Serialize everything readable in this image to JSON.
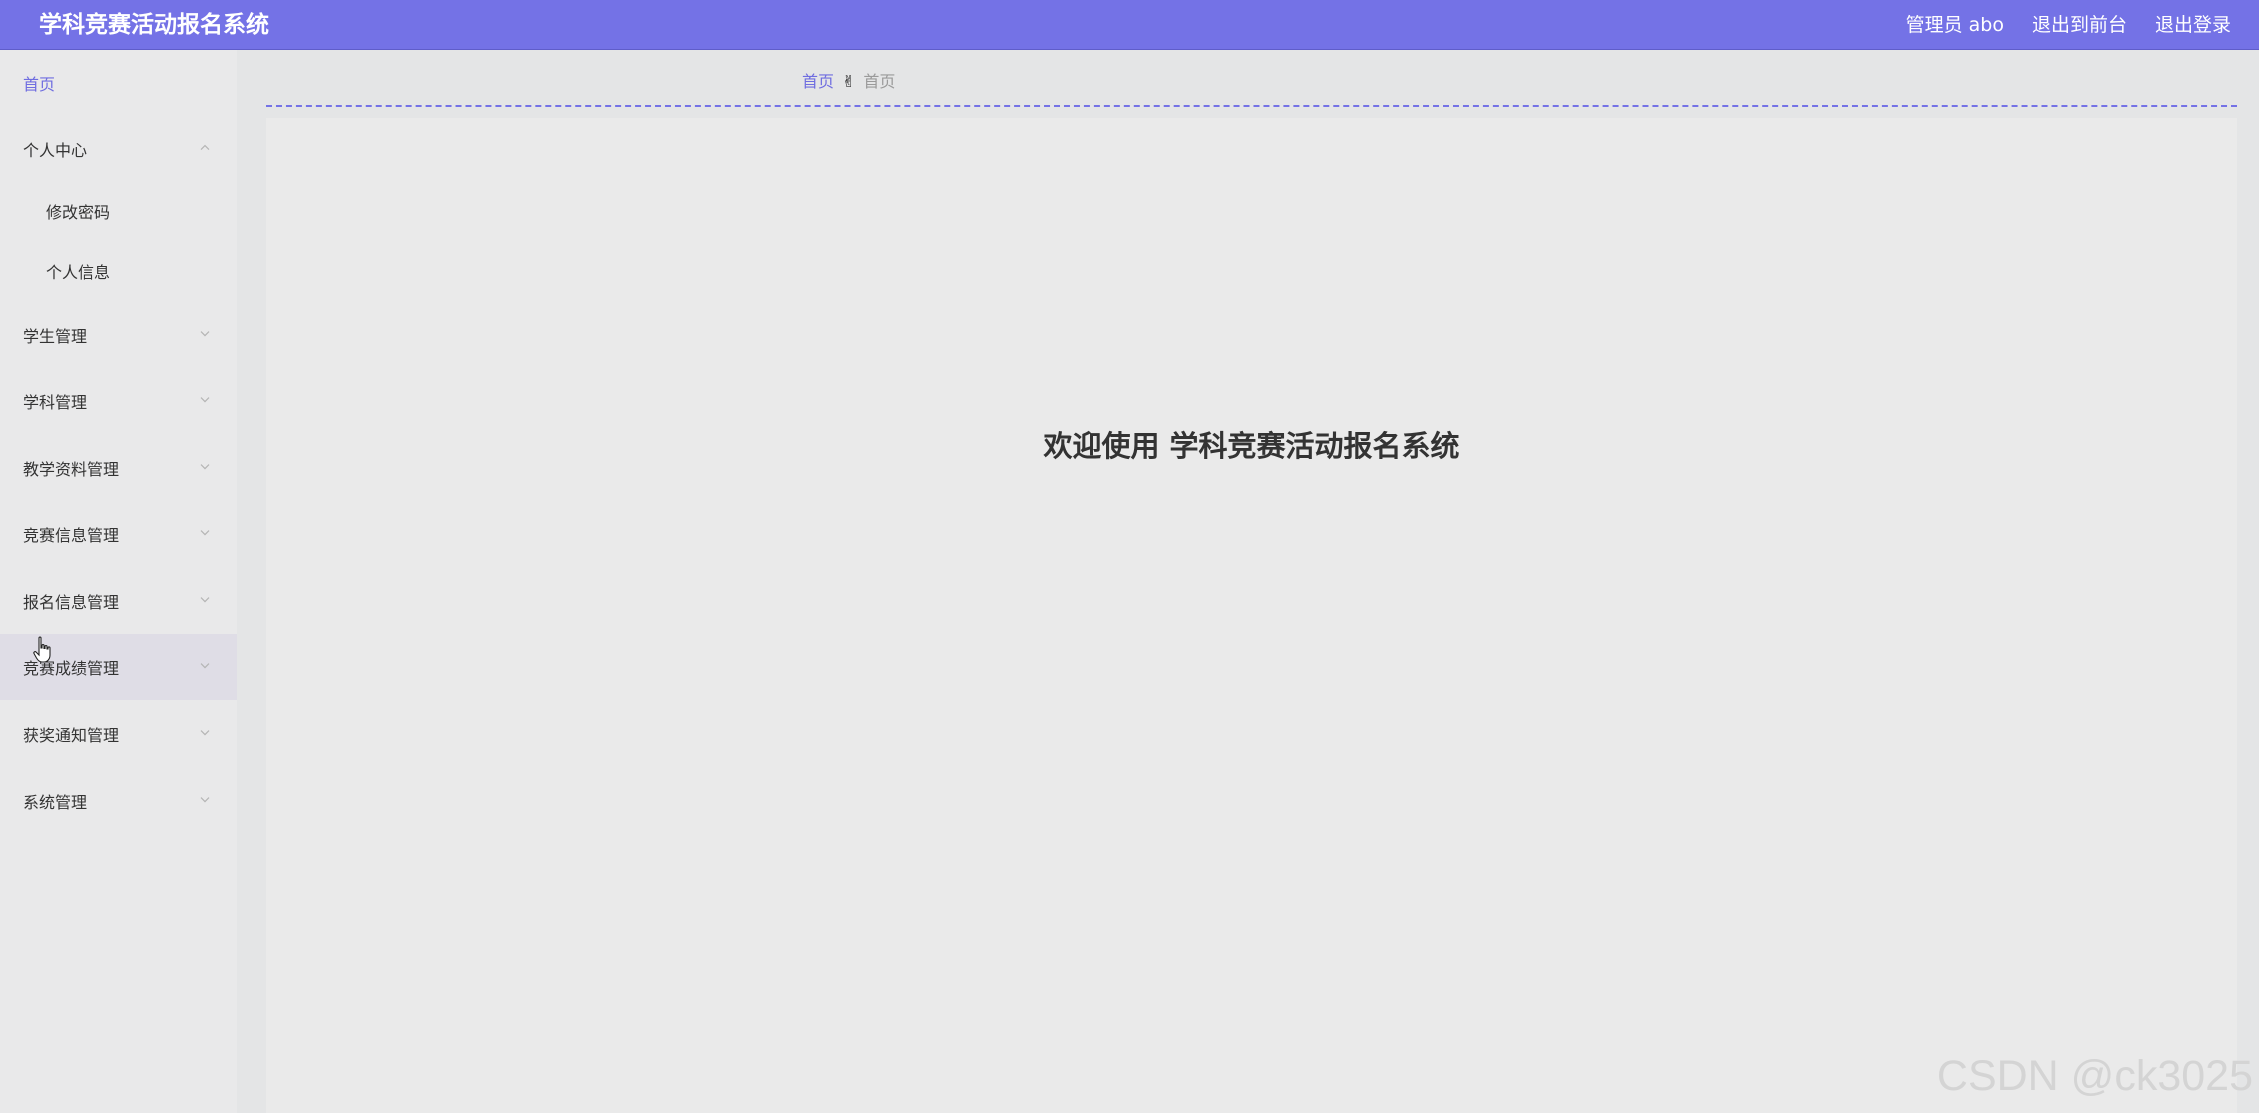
{
  "header": {
    "title": "学科竞赛活动报名系统",
    "user_label": "管理员 abo",
    "front_label": "退出到前台",
    "logout_label": "退出登录"
  },
  "sidebar": {
    "items": [
      {
        "label": "首页",
        "state": "link"
      },
      {
        "label": "个人中心",
        "state": "expanded"
      },
      {
        "label": "修改密码",
        "state": "sub"
      },
      {
        "label": "个人信息",
        "state": "sub"
      },
      {
        "label": "学生管理",
        "state": "collapsed"
      },
      {
        "label": "学科管理",
        "state": "collapsed"
      },
      {
        "label": "教学资料管理",
        "state": "collapsed"
      },
      {
        "label": "竞赛信息管理",
        "state": "collapsed"
      },
      {
        "label": "报名信息管理",
        "state": "collapsed"
      },
      {
        "label": "竞赛成绩管理",
        "state": "collapsed-hover"
      },
      {
        "label": "获奖通知管理",
        "state": "collapsed"
      },
      {
        "label": "系统管理",
        "state": "collapsed"
      }
    ]
  },
  "breadcrumb": {
    "home": "首页",
    "separator_icon": "hand-emoji",
    "separator_glyph": "✌",
    "current": "首页"
  },
  "main": {
    "welcome": "欢迎使用 学科竞赛活动报名系统"
  },
  "watermark": "CSDN @ck3025",
  "colors": {
    "accent": "#7472e6",
    "link": "#6f6de0",
    "dash": "#7472e6"
  }
}
